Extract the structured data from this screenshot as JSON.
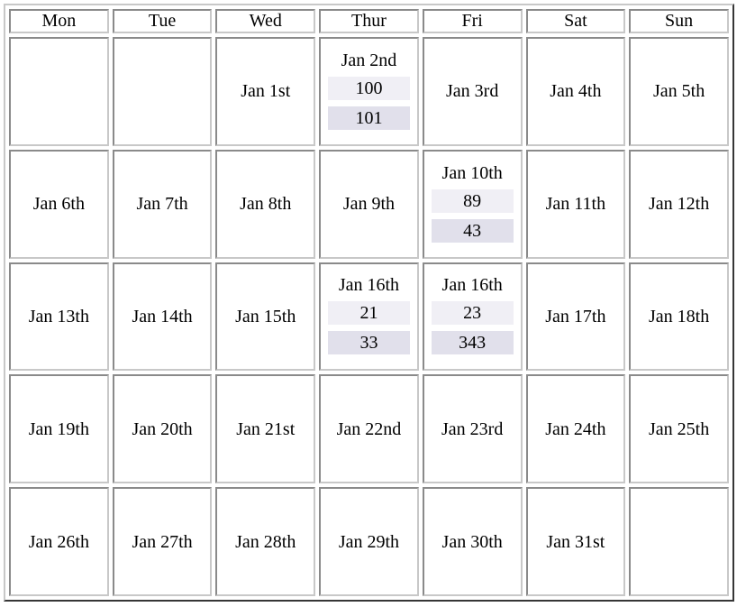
{
  "calendar": {
    "weekdays": [
      "Mon",
      "Tue",
      "Wed",
      "Thur",
      "Fri",
      "Sat",
      "Sun"
    ],
    "weeks": [
      [
        {
          "label": ""
        },
        {
          "label": ""
        },
        {
          "label": "Jan 1st"
        },
        {
          "label": "Jan 2nd",
          "values": [
            "100",
            "101"
          ]
        },
        {
          "label": "Jan 3rd"
        },
        {
          "label": "Jan 4th"
        },
        {
          "label": "Jan 5th"
        }
      ],
      [
        {
          "label": "Jan 6th"
        },
        {
          "label": "Jan 7th"
        },
        {
          "label": "Jan 8th"
        },
        {
          "label": "Jan 9th"
        },
        {
          "label": "Jan 10th",
          "values": [
            "89",
            "43"
          ]
        },
        {
          "label": "Jan 11th"
        },
        {
          "label": "Jan 12th"
        }
      ],
      [
        {
          "label": "Jan 13th"
        },
        {
          "label": "Jan 14th"
        },
        {
          "label": "Jan 15th"
        },
        {
          "label": "Jan 16th",
          "values": [
            "21",
            "33"
          ]
        },
        {
          "label": "Jan 16th",
          "values": [
            "23",
            "343"
          ]
        },
        {
          "label": "Jan 17th"
        },
        {
          "label": "Jan 18th"
        }
      ],
      [
        {
          "label": "Jan 19th"
        },
        {
          "label": "Jan 20th"
        },
        {
          "label": "Jan 21st"
        },
        {
          "label": "Jan 22nd"
        },
        {
          "label": "Jan 23rd"
        },
        {
          "label": "Jan 24th"
        },
        {
          "label": "Jan 25th"
        }
      ],
      [
        {
          "label": "Jan 26th"
        },
        {
          "label": "Jan 27th"
        },
        {
          "label": "Jan 28th"
        },
        {
          "label": "Jan 29th"
        },
        {
          "label": "Jan 30th"
        },
        {
          "label": "Jan 31st"
        },
        {
          "label": ""
        }
      ]
    ]
  },
  "colors": {
    "value_primary_bg": "#f0eff5",
    "value_secondary_bg": "#e1e0eb"
  }
}
